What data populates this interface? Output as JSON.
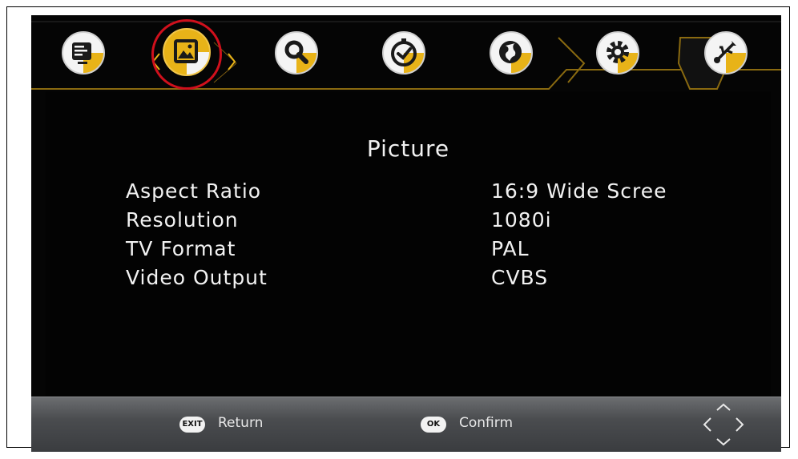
{
  "menu": {
    "items": [
      {
        "id": "program",
        "icon": "tv-list-icon"
      },
      {
        "id": "picture",
        "icon": "picture-icon",
        "selected": true
      },
      {
        "id": "search",
        "icon": "search-icon"
      },
      {
        "id": "time",
        "icon": "clock-icon"
      },
      {
        "id": "option",
        "icon": "globe-icon"
      },
      {
        "id": "system",
        "icon": "gear-icon"
      },
      {
        "id": "usb",
        "icon": "usb-icon"
      }
    ]
  },
  "page": {
    "title": "Picture"
  },
  "settings": [
    {
      "label": "Aspect Ratio",
      "value": "16:9 Wide Scree"
    },
    {
      "label": "Resolution",
      "value": "1080i"
    },
    {
      "label": "TV Format",
      "value": "PAL"
    },
    {
      "label": "Video Output",
      "value": "CVBS"
    }
  ],
  "footer": {
    "exit_key": "EXIT",
    "exit_label": "Return",
    "ok_key": "OK",
    "ok_label": "Confirm"
  },
  "colors": {
    "accent": "#e8b318",
    "selection_ring": "#d0101c",
    "background": "#050505",
    "text": "#f2f2f2"
  }
}
